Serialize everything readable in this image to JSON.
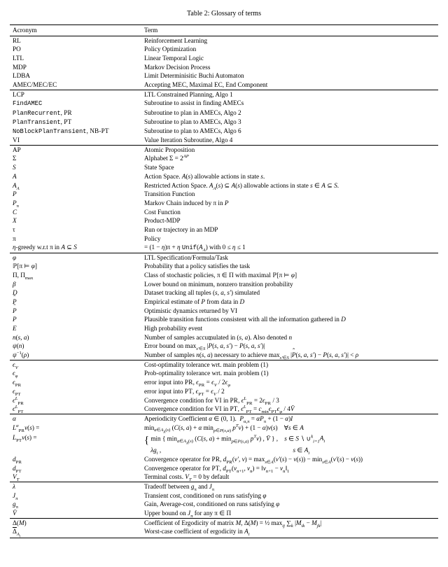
{
  "caption": "Table 2: Glossary of terms",
  "headers": {
    "acr": "Acronym",
    "term": "Term"
  },
  "rows": [
    {
      "sect": true,
      "a": "RL",
      "t": "Reinforcement Learning"
    },
    {
      "a": "PO",
      "t": "Policy Optimization"
    },
    {
      "a": "LTL",
      "t": "Linear Temporal Logic"
    },
    {
      "a": "MDP",
      "t": "Markov Decision Process"
    },
    {
      "a": "LDBA",
      "t": "Limit Determinisitic Buchi Automaton"
    },
    {
      "a": "AMEC/MEC/EC",
      "t": "Accepting MEC, Maximal EC, End Component"
    },
    {
      "sect": true,
      "a": "LCP",
      "t": "LTL Constrained Planning, Algo 1"
    },
    {
      "a_html": "<span class='tt'>FindAMEC</span>",
      "t": "Subroutine to assist in finding AMECs"
    },
    {
      "a_html": "<span class='tt'>PlanRecurrent</span>, <span class='sc'>PR</span>",
      "t": "Subroutine to plan in AMECs, Algo 2"
    },
    {
      "a_html": "<span class='tt'>PlanTransient</span>, <span class='sc'>PT</span>",
      "t": "Subroutine to plan to AMECs, Algo 3"
    },
    {
      "a_html": "<span class='tt'>NoBlockPlanTransient</span>, <span class='sc'>NB-PT</span>",
      "t": "Subroutine to plan to AMECs, Algo 6"
    },
    {
      "a_html": "<span class='sc'>VI</span>",
      "t": "Value Iteration Subroutine, Algo 4"
    },
    {
      "sect": true,
      "a": "AP",
      "t": "Atomic Proposition"
    },
    {
      "a_html": "Σ",
      "t_html": "Alphabet Σ = 2<span class='sup'><span class='it'>AP</span></span>"
    },
    {
      "a_html": "<span class='cal'>S</span>",
      "t": "State Space"
    },
    {
      "a_html": "<span class='cal'>A</span>",
      "t_html": "Action Space. <span class='cal'>A</span>(<span class='it'>s</span>) allowable actions in state <span class='it'>s</span>."
    },
    {
      "a_html": "<span class='cal'>A</span><span class='sub'><span class='it'>A</span></span>",
      "t_html": "Restricted Action Space. <span class='cal'>A</span><span class='sub'><span class='it'>A</span></span>(<span class='it'>s</span>) ⊆ <span class='cal'>A</span>(<span class='it'>s</span>) allowable actions in state <span class='it'>s</span> ∈ <span class='it'>A</span> ⊆ <span class='cal'>S</span>."
    },
    {
      "a_html": "<span class='it'>P</span>",
      "t": "Transition Function"
    },
    {
      "a_html": "<span class='it'>P</span><span class='sub'>π</span>",
      "t_html": "Markov Chain induced by π in <span class='it'>P</span>"
    },
    {
      "a_html": "<span class='cal'>C</span>",
      "t": "Cost Function"
    },
    {
      "a_html": "<span class='cal'>X</span>",
      "t": "Product-MDP"
    },
    {
      "a_html": "τ",
      "t": "Run or trajectory in an MDP"
    },
    {
      "a_html": "π",
      "t": "Policy"
    },
    {
      "a_html": "<span class='it'>η</span>-greedy w.r.t π in <span class='it'>A</span> ⊆ <span class='cal'>S</span>",
      "t_html": "= (1 − <span class='it'>η</span>)π + <span class='it'>η</span> <span class='tt'>Unif</span>(<span class='cal'>A</span><span class='sub'><span class='it'>A</span></span>) with 0 ≤ <span class='it'>η</span> ≤ 1"
    },
    {
      "sect": true,
      "a_html": "<span class='it'>φ</span>",
      "t": "LTL Specification/Formula/Task"
    },
    {
      "a_html": "ℙ[π ⊨ <span class='it'>φ</span>]",
      "t": "Probability that a policy satisfies the task"
    },
    {
      "a_html": "Π, Π<span class='sub'>max</span>",
      "t_html": "Class of stochastic policies, π ∈ Π with maximal ℙ[π ⊨ <span class='it'>φ</span>]"
    },
    {
      "a_html": "<span class='it'>β</span>",
      "t": "Lower bound on minimum, nonzero transition probability"
    },
    {
      "a_html": "<span class='it'>D</span>",
      "t_html": "Dataset tracking all tuples (<span class='it'>s, a, s′</span>) simulated"
    },
    {
      "a_html": "<span class='hat'><span class='it'>P</span></span>",
      "t_html": "Empirical estimate of <span class='it'>P</span> from data in <span class='it'>D</span>"
    },
    {
      "a_html": "<span class='tilde'><span class='it'>P</span></span>",
      "t_html": "Optimistic dynamics returned by <span class='sc'>VI</span>"
    },
    {
      "a_html": "<span class='cal'>P</span>",
      "t_html": "Plausible transition functions consistent with all the information gathered in <span class='it'>D</span>"
    },
    {
      "a_html": "<span class='cal'>E</span>",
      "t": "High probability event"
    },
    {
      "a_html": "<span class='it'>n</span>(<span class='it'>s, a</span>)",
      "t_html": "Number of samples accumulated in (<span class='it'>s, a</span>). Also denoted <span class='it'>n</span>"
    },
    {
      "a_html": "<span class='it'>ψ</span>(<span class='it'>n</span>)",
      "t_html": "Error bound on max<span class='sub'><span class='it'>s′</span>∈<span class='cal'>S</span></span> |<span class='hat'><span class='it'>P</span></span>(<span class='it'>s, a, s′</span>) − <span class='it'>P</span>(<span class='it'>s, a, s′</span>)|"
    },
    {
      "a_html": "<span class='it'>ψ</span><span class='sup'>−1</span>(<span class='it'>ρ</span>)",
      "t_html": "Number of samples <span class='it'>n</span>(<span class='it'>s, a</span>) necessary to achieve max<span class='sub'><span class='it'>s′</span>∈<span class='cal'>S</span></span> |<span class='hat'><span class='it'>P</span></span>(<span class='it'>s, a, s′</span>) − <span class='it'>P</span>(<span class='it'>s, a, s′</span>)| &lt; <span class='it'>ρ</span>"
    },
    {
      "sect": true,
      "a_html": "<span class='it'>ϵ</span><span class='sub'><span class='it'>V</span></span>",
      "t": "Cost-optimality tolerance wrt. main problem (1)"
    },
    {
      "a_html": "<span class='it'>ϵ</span><span class='sub'><span class='it'>φ</span></span>",
      "t": "Prob-optimality tolerance wrt. main problem (1)"
    },
    {
      "a_html": "<span class='it'>ϵ</span><span class='sub sc'>PR</span>",
      "t_html": "error input into <span class='sc'>PR</span>, <span class='it'>ϵ</span><span class='sub sc'>PR</span> = <span class='it'>ϵ</span><span class='sub it'>V</span> / 2<span class='it'>ϵ</span><span class='sub it'>φ</span>"
    },
    {
      "a_html": "<span class='it'>ϵ</span><span class='sub sc'>PT</span>",
      "t_html": "error input into <span class='sc'>PT</span>, <span class='it'>ϵ</span><span class='sub sc'>PT</span> = <span class='it'>ϵ</span><span class='sub it'>V</span> / 2"
    },
    {
      "a_html": "<span class='it'>ϵ</span><span class='sup cal'>L</span><span class='sub sc'>PR</span>",
      "t_html": "Convergence condition for <span class='sc'>VI</span> in <span class='sc'>PR</span>, <span class='it'>ϵ</span><span class='sup cal'>L</span><span class='sub sc'>PR</span> = 2<span class='it'>ϵ</span><span class='sub sc'>PR</span> / 3"
    },
    {
      "a_html": "<span class='it'>ϵ</span><span class='sup cal'>L</span><span class='sub sc'>PT</span>",
      "t_html": "Convergence condition for <span class='sc'>VI</span> in <span class='sc'>PT</span>, <span class='it'>ϵ</span><span class='sup cal'>L</span><span class='sub sc'>PT</span> = <span class='it'>c</span><span class='sub'>min</span><span class='it'>ϵ</span><span class='sub sc'>PT</span><span class='it'>ϵ</span><span class='sub it'>φ</span> / 4<span class='it'>V̄</span>"
    },
    {
      "sect": true,
      "a_html": "<span class='it'>α</span>",
      "t_html": "Aperiodicity Coefficient <span class='it'>α</span> ∈ (0, 1). &nbsp;<span class='it'>P</span><span class='sub'>α,π</span> = <span class='it'>αP</span><span class='sub'>π</span> + (1 − <span class='it'>α</span>)<span class='it'>I</span>"
    },
    {
      "a_html": "<span class='cal'>L</span><span class='sup it'>α</span><span class='sub sc'>PR</span><span class='it'>v</span>(<span class='it'>s</span>) =",
      "t_html": "min<span class='sub'><span class='it'>a</span>∈<span class='cal'>A</span><span class='sub it'>A</span>(<span class='it'>s</span>)</span> (<span class='cal'>C</span>(<span class='it'>s, a</span>) + <span class='it'>α</span> min<span class='sub'><span class='it'>p</span>∈<span class='cal'>P</span>(<span class='it'>s,a</span>)</span> <span class='it'>p</span><span class='sup it'>T</span><span class='it'>v</span>) + (1 − <span class='it'>α</span>)<span class='it'>v</span>(<span class='it'>s</span>) &nbsp;&nbsp; ∀<span class='it'>s</span> ∈ <span class='it'>A</span>"
    },
    {
      "a_html": "<span class='cal'>L</span><span class='sub sc'>PT</span><span class='it'>v</span>(<span class='it'>s</span>) =",
      "t_html": "<span style='font-size:1.6em;vertical-align:-.24em'>{</span> min { min<span class='sub'><span class='it'>a</span>∈<span class='cal'>A</span><span class='sub it'>A</span>(<span class='it'>s</span>)</span> (<span class='cal'>C</span>(<span class='it'>s, a</span>) + min<span class='sub'><span class='it'>p</span>∈<span class='cal'>P</span>(<span class='it'>s,a</span>)</span> <span class='it'>p</span><span class='sup it'>T</span><span class='it'>v</span>) , <span class='it'>V̄</span> } , &nbsp;&nbsp; <span class='it'>s</span> ∈ <span class='cal'>S</span> ∖ ∪<span class='sup it'>k</span><span class='sub it'>i=1</span><span class='it'>A<span class='sub'>i</span></span><br>&nbsp;&nbsp;&nbsp; <span class='it'>λg<span class='sub'>i</span></span> , &nbsp;&nbsp;&nbsp;&nbsp;&nbsp;&nbsp;&nbsp;&nbsp;&nbsp;&nbsp;&nbsp;&nbsp;&nbsp;&nbsp;&nbsp;&nbsp;&nbsp;&nbsp;&nbsp;&nbsp;&nbsp;&nbsp;&nbsp;&nbsp;&nbsp;&nbsp;&nbsp;&nbsp;&nbsp;&nbsp;&nbsp;&nbsp;&nbsp;&nbsp;&nbsp;&nbsp;&nbsp;&nbsp;&nbsp;&nbsp;&nbsp;&nbsp;&nbsp;&nbsp;&nbsp;&nbsp;&nbsp;&nbsp;&nbsp;&nbsp;&nbsp;&nbsp;&nbsp;&nbsp;&nbsp;&nbsp;&nbsp;&nbsp;&nbsp;&nbsp;&nbsp;&nbsp;&nbsp;&nbsp;&nbsp;&nbsp;&nbsp;&nbsp;&nbsp;&nbsp;&nbsp;&nbsp;&nbsp;&nbsp;&nbsp;&nbsp;&nbsp;&nbsp;&nbsp;&nbsp; <span class='it'>s</span> ∈ <span class='it'>A<span class='sub'>i</span></span>"
    },
    {
      "a_html": "<span class='it'>d</span><span class='sub sc'>PR</span>",
      "t_html": "Convergence operator for <span class='sc'>PR</span>, <span class='it'>d</span><span class='sub sc'>PR</span>(<span class='it'>v′, v</span>) = max<span class='sub'><span class='it'>s</span>∈<span class='it'>A</span></span>(<span class='it'>v′</span>(<span class='it'>s</span>) − <span class='it'>v</span>(<span class='it'>s</span>)) − min<span class='sub'><span class='it'>s</span>∈<span class='it'>A</span></span>(<span class='it'>v′</span>(<span class='it'>s</span>) − <span class='it'>v</span>(<span class='it'>s</span>))"
    },
    {
      "a_html": "<span class='it'>d</span><span class='sub sc'>PT</span>",
      "t_html": "Convergence operator for <span class='sc'>PT</span>, <span class='it'>d</span><span class='sub sc'>PT</span>(<span class='it'>v</span><span class='sub'>n+1</span>, <span class='it'>v</span><span class='sub'>n</span>) = ‖<span class='it'>v</span><span class='sub'>n+1</span> − <span class='it'>v</span><span class='sub'>n</span>‖<span class='sub'>1</span>"
    },
    {
      "a_html": "<span class='it'>V</span><span class='sub'><span class='it'>T</span></span>",
      "t_html": "Terminal costs. <span class='it'>V</span><span class='sub it'>T</span> = 0 by default"
    },
    {
      "sect": true,
      "a_html": "<span class='it'>λ</span>",
      "t_html": "Tradeoff between <span class='it'>g</span><span class='sub'>π</span> and <span class='it'>J</span><span class='sub'>π</span>"
    },
    {
      "a_html": "<span class='it'>J</span><span class='sub'>π</span>",
      "t_html": "Transient cost, conditioned on runs satisfying <span class='it'>φ</span>"
    },
    {
      "a_html": "<span class='it'>g</span><span class='sub'>π</span>",
      "t_html": "Gain, Average-cost, conditioned on runs satisfying <span class='it'>φ</span>"
    },
    {
      "a_html": "<span class='it'>V̄</span>",
      "t_html": "Upper bound on <span class='it'>J</span><span class='sub'>π</span> for any π ∈ Π"
    },
    {
      "dbl": true,
      "a_html": "Δ(<span class='it'>M</span>)",
      "t_html": "Coefficient of Ergodicity of matrix <span class='it'>M</span>, Δ(<span class='it'>M</span>) = ½ max<span class='sub it'>ij</span> ∑<span class='sub it'>k</span> |<span class='it'>M</span><span class='sub it'>ik</span> − <span class='it'>M</span><span class='sub it'>jk</span>|"
    },
    {
      "bot": true,
      "a_html": "<span class='ov'>Δ</span><span class='sub'><span class='it'>A</span><span class='sub it'>i</span></span>",
      "t_html": "Worst-case coefficient of ergodicity in <span class='it'>A</span><span class='sub it'>i</span>"
    }
  ]
}
